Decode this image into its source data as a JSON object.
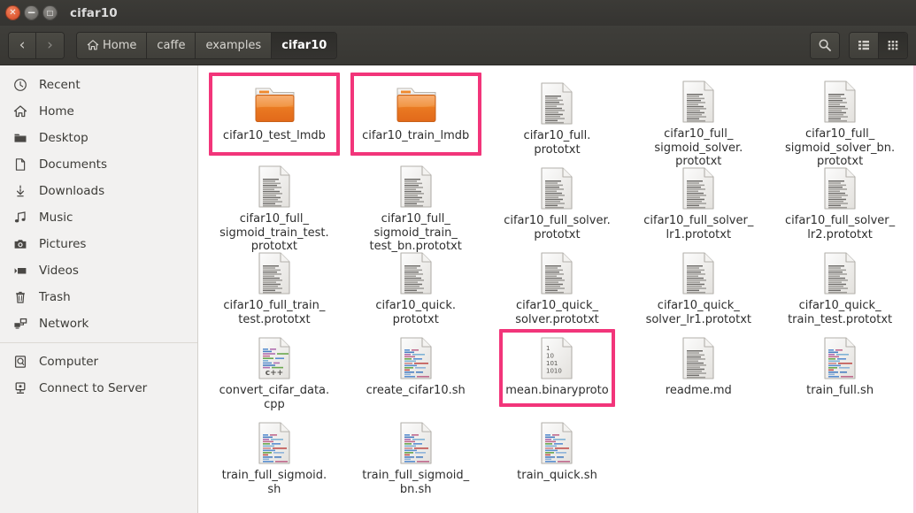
{
  "window": {
    "title": "cifar10",
    "controls": [
      {
        "name": "close",
        "glyph": "✕"
      },
      {
        "name": "minimize",
        "glyph": "−"
      },
      {
        "name": "maximize",
        "glyph": "□"
      }
    ]
  },
  "toolbar": {
    "back_label": "‹",
    "forward_label": "›",
    "breadcrumbs": [
      {
        "label": "Home",
        "icon": "home-icon",
        "active": false
      },
      {
        "label": "caffe",
        "icon": "",
        "active": false
      },
      {
        "label": "examples",
        "icon": "",
        "active": false
      },
      {
        "label": "cifar10",
        "icon": "",
        "active": true
      }
    ],
    "search_icon": "search-icon",
    "list_view_icon": "list-view-icon",
    "grid_view_icon": "grid-view-icon",
    "active_view": "grid"
  },
  "sidebar": {
    "items": [
      {
        "label": "Recent",
        "icon": "clock-icon"
      },
      {
        "label": "Home",
        "icon": "home-icon"
      },
      {
        "label": "Desktop",
        "icon": "folder-icon"
      },
      {
        "label": "Documents",
        "icon": "document-icon"
      },
      {
        "label": "Downloads",
        "icon": "download-icon"
      },
      {
        "label": "Music",
        "icon": "music-icon"
      },
      {
        "label": "Pictures",
        "icon": "camera-icon"
      },
      {
        "label": "Videos",
        "icon": "video-icon"
      },
      {
        "label": "Trash",
        "icon": "trash-icon"
      },
      {
        "label": "Network",
        "icon": "network-icon"
      }
    ],
    "items_bottom": [
      {
        "label": "Computer",
        "icon": "computer-icon"
      },
      {
        "label": "Connect to Server",
        "icon": "server-icon"
      }
    ]
  },
  "colors": {
    "highlight": "#f2357a",
    "folder": "#f0802a",
    "titlebar": "#3c3b37",
    "sidebar_bg": "#f2f1f0"
  },
  "files": [
    {
      "name": "cifar10_test_lmdb",
      "type": "folder",
      "highlighted": true
    },
    {
      "name": "cifar10_train_lmdb",
      "type": "folder",
      "highlighted": true
    },
    {
      "name": "cifar10_full.\nprototxt",
      "type": "text",
      "highlighted": false
    },
    {
      "name": "cifar10_full_\nsigmoid_solver.\nprototxt",
      "type": "text",
      "highlighted": false
    },
    {
      "name": "cifar10_full_\nsigmoid_solver_bn.\nprototxt",
      "type": "text",
      "highlighted": false
    },
    {
      "name": "cifar10_full_\nsigmoid_train_test.\nprototxt",
      "type": "text",
      "highlighted": false
    },
    {
      "name": "cifar10_full_\nsigmoid_train_\ntest_bn.prototxt",
      "type": "text",
      "highlighted": false
    },
    {
      "name": "cifar10_full_solver.\nprototxt",
      "type": "text",
      "highlighted": false
    },
    {
      "name": "cifar10_full_solver_\nlr1.prototxt",
      "type": "text",
      "highlighted": false
    },
    {
      "name": "cifar10_full_solver_\nlr2.prototxt",
      "type": "text",
      "highlighted": false
    },
    {
      "name": "cifar10_full_train_\ntest.prototxt",
      "type": "text",
      "highlighted": false
    },
    {
      "name": "cifar10_quick.\nprototxt",
      "type": "text",
      "highlighted": false
    },
    {
      "name": "cifar10_quick_\nsolver.prototxt",
      "type": "text",
      "highlighted": false
    },
    {
      "name": "cifar10_quick_\nsolver_lr1.prototxt",
      "type": "text",
      "highlighted": false
    },
    {
      "name": "cifar10_quick_\ntrain_test.prototxt",
      "type": "text",
      "highlighted": false
    },
    {
      "name": "convert_cifar_data.\ncpp",
      "type": "cpp",
      "highlighted": false
    },
    {
      "name": "create_cifar10.sh",
      "type": "script",
      "highlighted": false
    },
    {
      "name": "mean.binaryproto",
      "type": "binary",
      "highlighted": true
    },
    {
      "name": "readme.md",
      "type": "text",
      "highlighted": false
    },
    {
      "name": "train_full.sh",
      "type": "script",
      "highlighted": false
    },
    {
      "name": "train_full_sigmoid.\nsh",
      "type": "script",
      "highlighted": false
    },
    {
      "name": "train_full_sigmoid_\nbn.sh",
      "type": "script",
      "highlighted": false
    },
    {
      "name": "train_quick.sh",
      "type": "script",
      "highlighted": false
    }
  ],
  "binary_icon_lines": [
    "1",
    "10",
    "101",
    "1010"
  ],
  "cpp_icon_label": "c++"
}
